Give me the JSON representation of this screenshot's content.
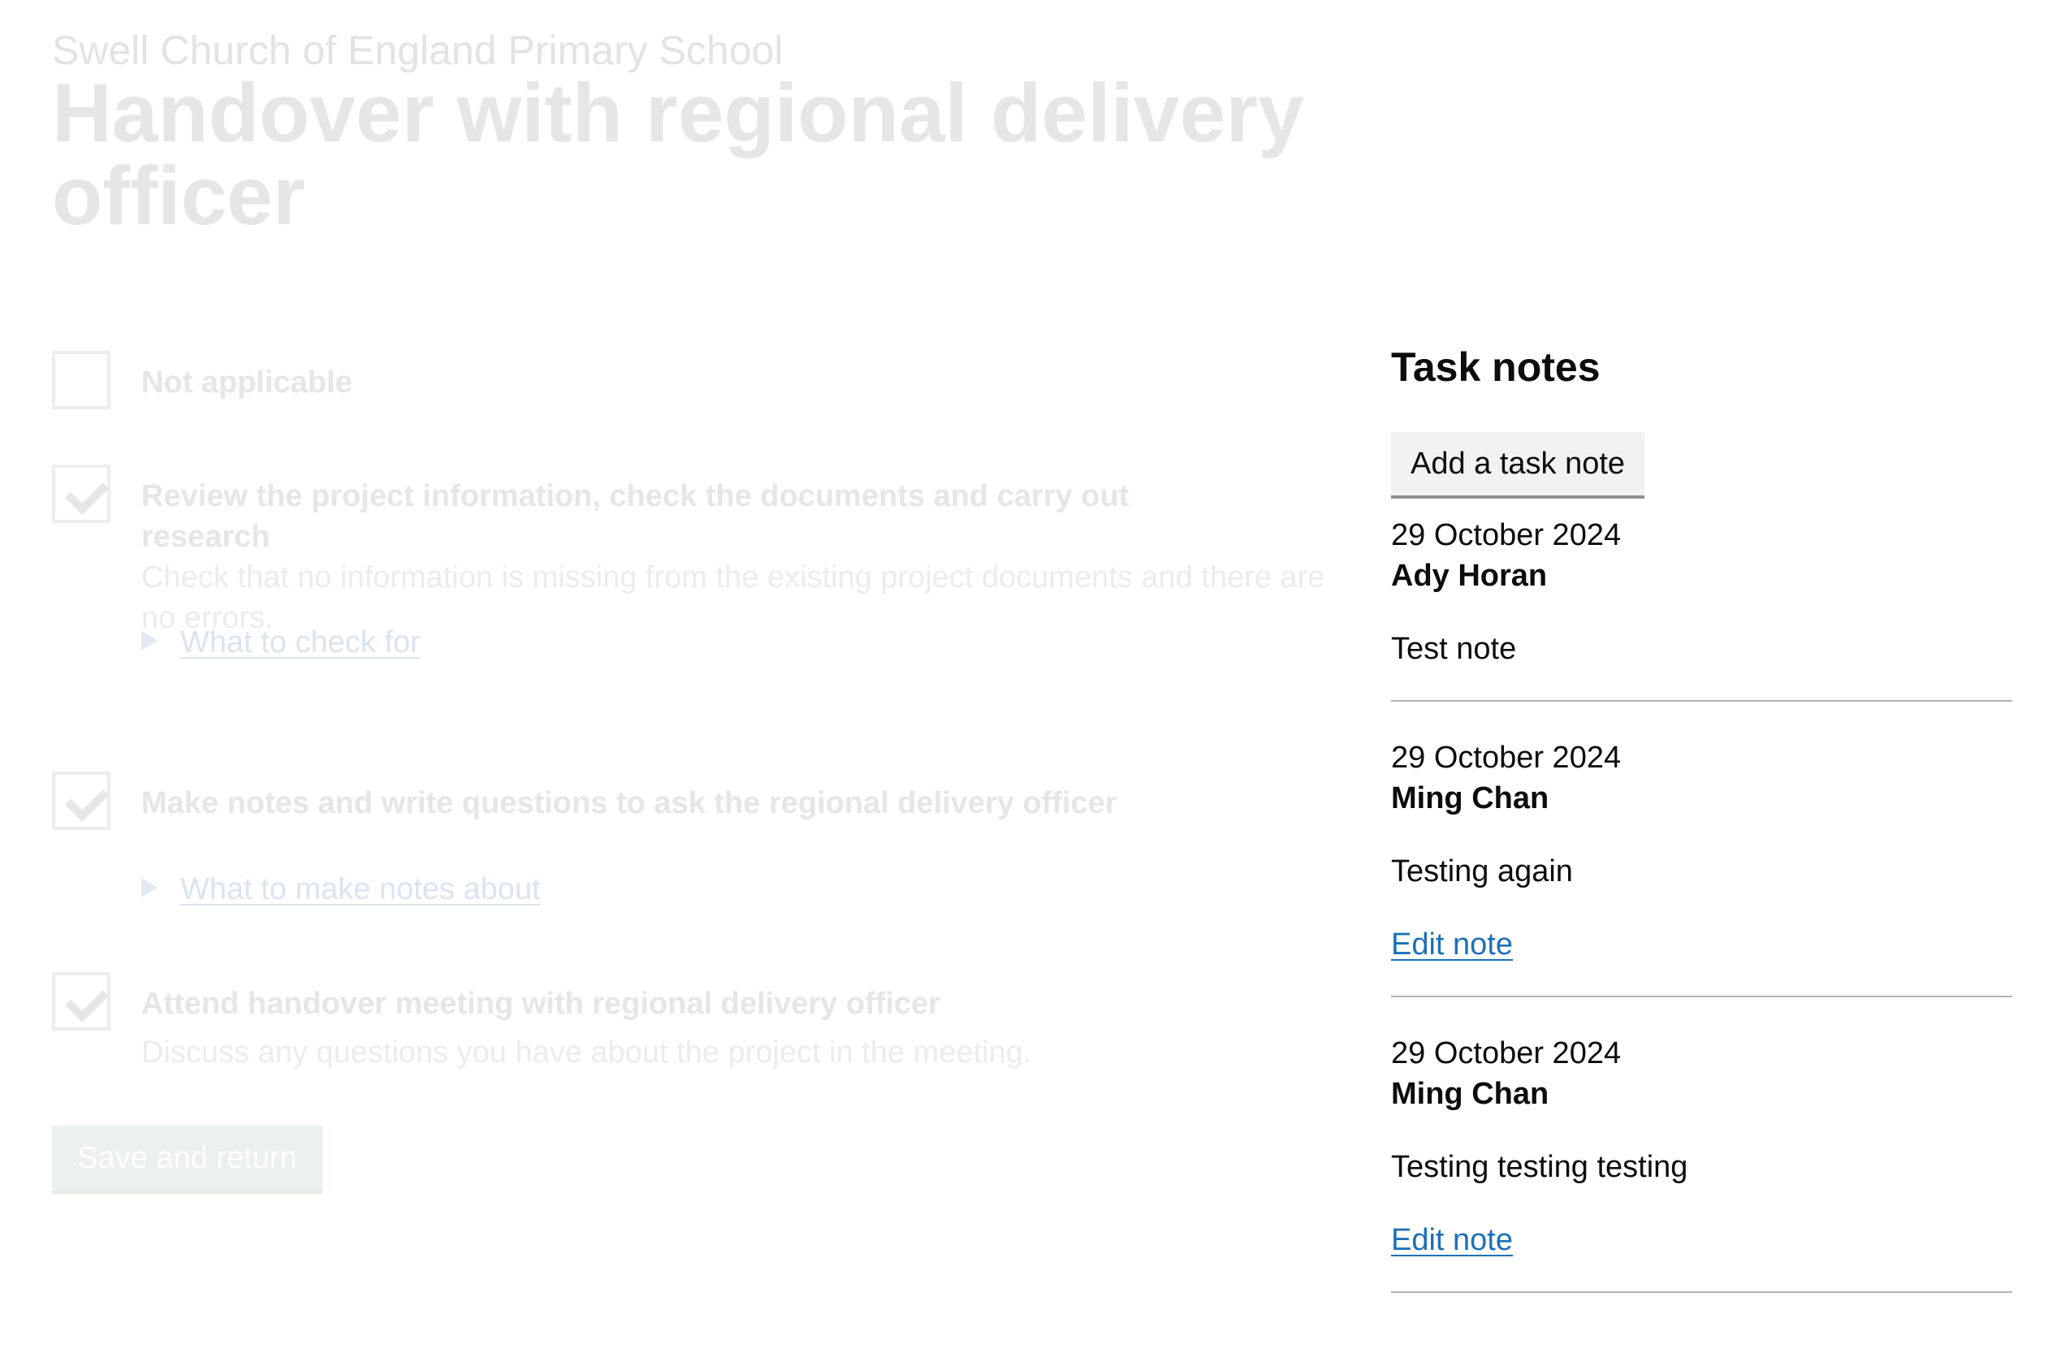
{
  "header": {
    "caption": "Swell Church of England Primary School",
    "title": "Handover with regional delivery officer"
  },
  "tasks": [
    {
      "label": "Not applicable",
      "checked": false
    },
    {
      "label": "Review the project information, check the documents and carry out research",
      "checked": true,
      "hint": "Check that no information is missing from the existing project documents and there are no errors.",
      "details": "What to check for"
    },
    {
      "label": "Make notes and write questions to ask the regional delivery officer",
      "checked": true,
      "details": "What to make notes about"
    },
    {
      "label": "Attend handover meeting with regional delivery officer",
      "checked": true,
      "hint": "Discuss any questions you have about the project in the meeting."
    }
  ],
  "save_button": "Save and return",
  "notes_panel": {
    "heading": "Task notes",
    "add_button": "Add a task note",
    "notes": [
      {
        "date": "29 October 2024",
        "author": "Ady Horan",
        "body": "Test note"
      },
      {
        "date": "29 October 2024",
        "author": "Ming Chan",
        "body": "Testing again",
        "edit": "Edit note"
      },
      {
        "date": "29 October 2024",
        "author": "Ming Chan",
        "body": "Testing testing testing",
        "edit": "Edit note"
      }
    ]
  },
  "colors": {
    "link": "#1d70b8",
    "text": "#0b0c0c",
    "faded_text": "#e6e6e6",
    "divider": "#b1b4b6",
    "secondary_button": "#f3f2f1"
  }
}
